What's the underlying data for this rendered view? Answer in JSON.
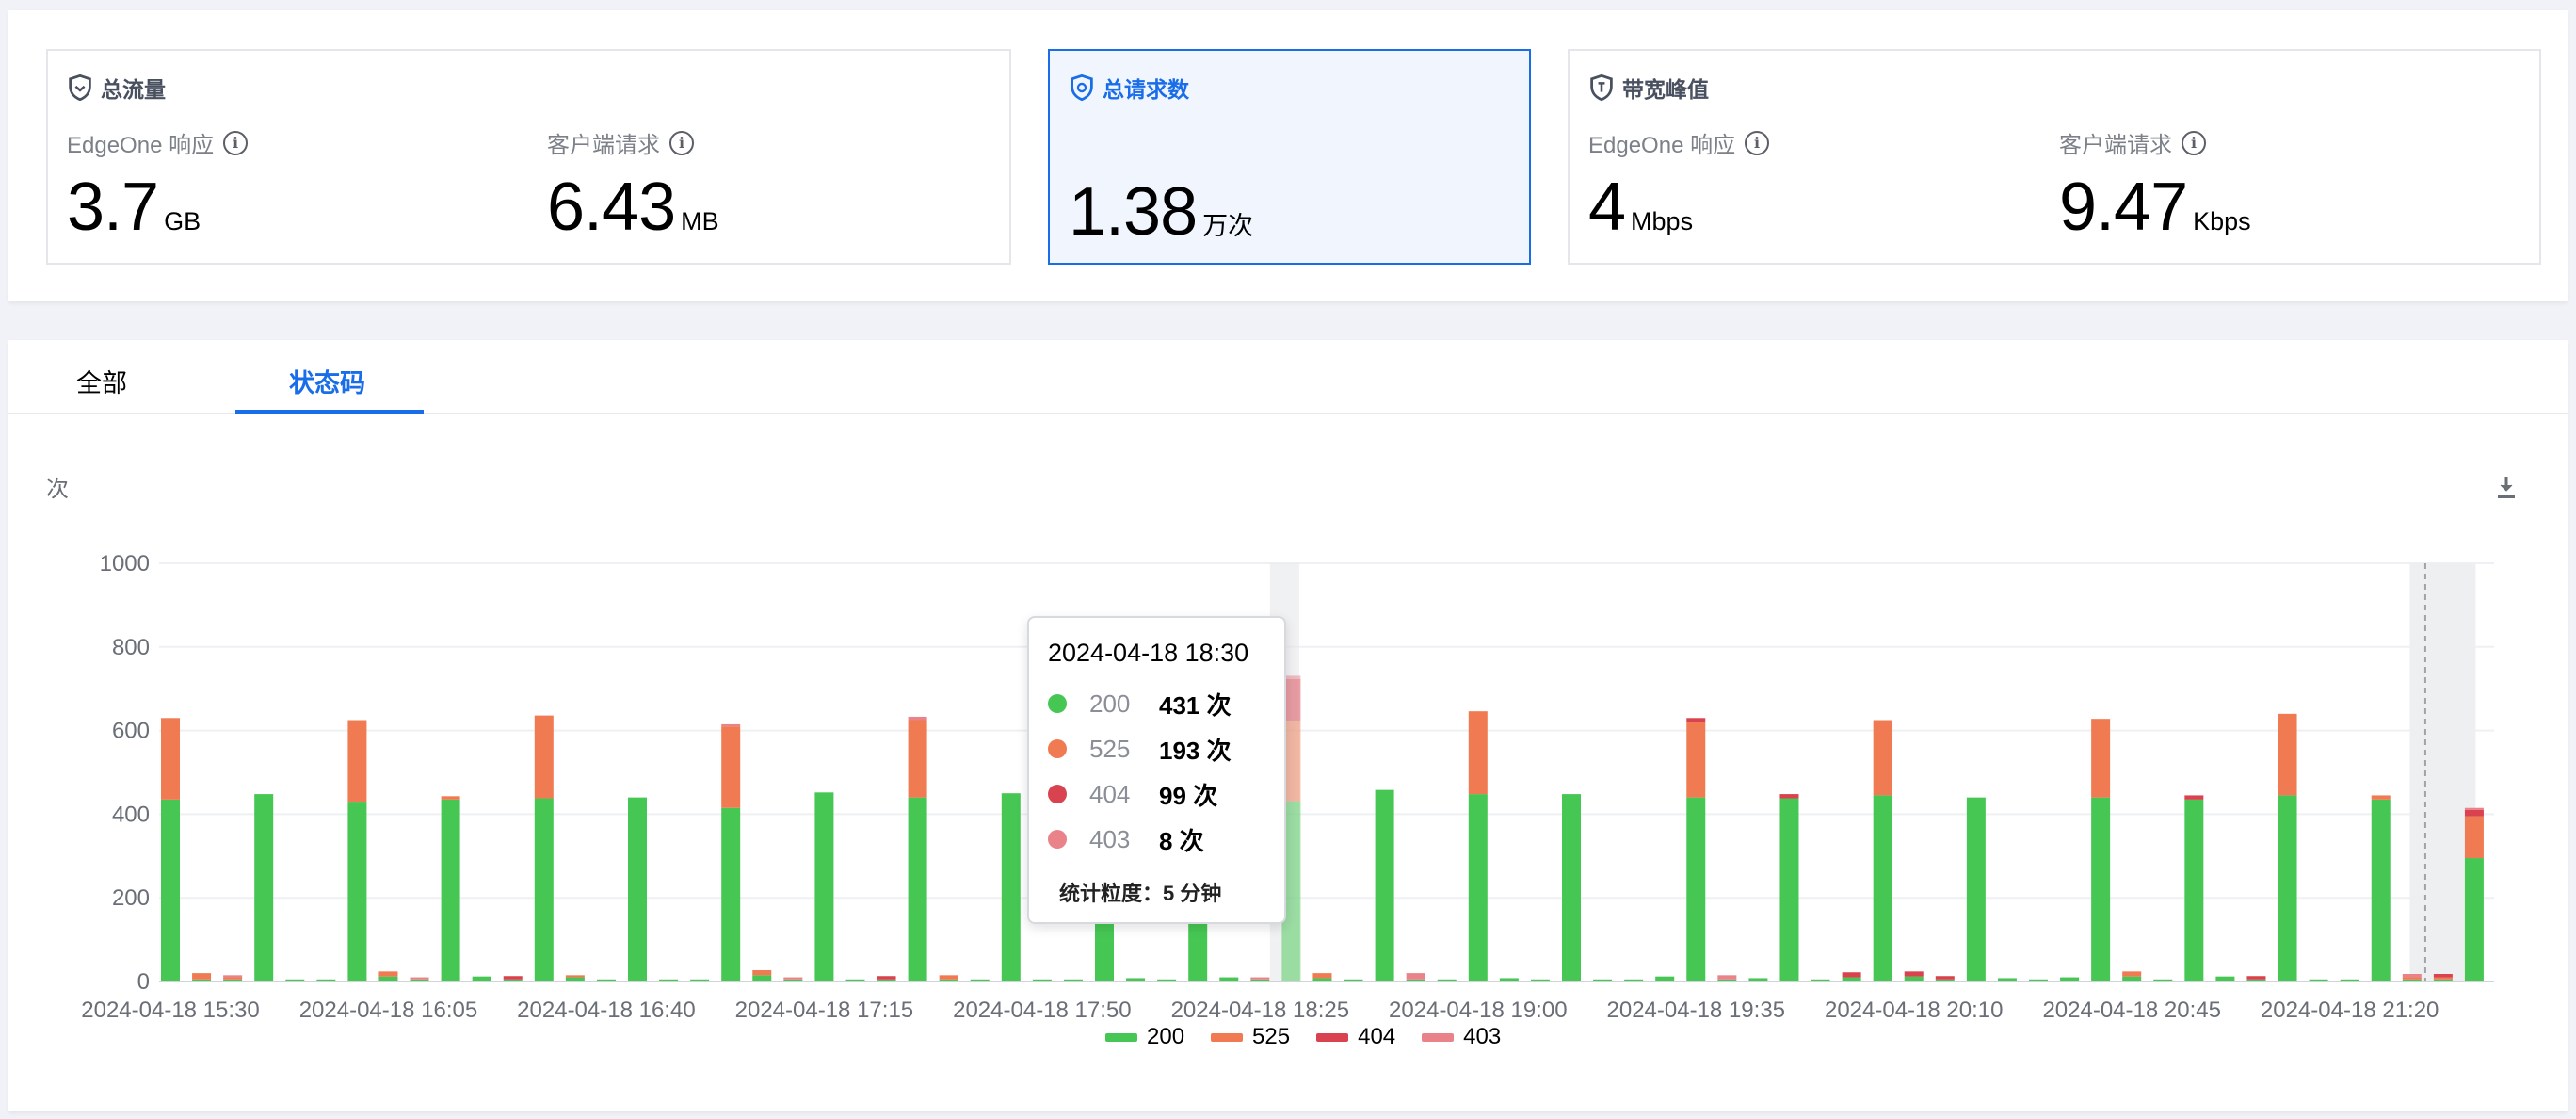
{
  "metrics": {
    "traffic": {
      "title": "总流量",
      "edge": {
        "label": "EdgeOne 响应",
        "value": "3.7",
        "unit": "GB"
      },
      "client": {
        "label": "客户端请求",
        "value": "6.43",
        "unit": "MB"
      }
    },
    "requests": {
      "title": "总请求数",
      "total": {
        "value": "1.38",
        "unit": "万次"
      }
    },
    "bandwidth": {
      "title": "带宽峰值",
      "edge": {
        "label": "EdgeOne 响应",
        "value": "4",
        "unit": "Mbps"
      },
      "client": {
        "label": "客户端请求",
        "value": "9.47",
        "unit": "Kbps"
      }
    }
  },
  "tabs": [
    {
      "label": "全部"
    },
    {
      "label": "状态码",
      "active": true
    }
  ],
  "chart_unit": "次",
  "colors": {
    "c200": "#46c753",
    "c525": "#f07b52",
    "c404": "#d9434f",
    "c403": "#ea8289",
    "accent": "#1a6de8"
  },
  "icons": {
    "shield": "shield-icon",
    "info": "info-icon",
    "download": "download-icon"
  },
  "tooltip": {
    "title": "2024-04-18 18:30",
    "rows": [
      {
        "code": "200",
        "value": "431 次"
      },
      {
        "code": "525",
        "value": "193 次"
      },
      {
        "code": "404",
        "value": "99 次"
      },
      {
        "code": "403",
        "value": "8 次"
      }
    ],
    "footer": "统计粒度：5 分钟"
  },
  "chart_data": {
    "type": "bar",
    "stacked": true,
    "ylim": [
      0,
      1000
    ],
    "yticks": [
      0,
      200,
      400,
      600,
      800,
      1000
    ],
    "x_tick_labels": [
      "2024-04-18 15:30",
      "2024-04-18 16:05",
      "2024-04-18 16:40",
      "2024-04-18 17:15",
      "2024-04-18 17:50",
      "2024-04-18 18:25",
      "2024-04-18 19:00",
      "2024-04-18 19:35",
      "2024-04-18 20:10",
      "2024-04-18 20:45",
      "2024-04-18 21:20"
    ],
    "x_tick_indices": [
      0,
      7,
      14,
      21,
      28,
      35,
      42,
      49,
      56,
      63,
      70
    ],
    "highlight_index": 36,
    "grid": true,
    "legend": "bottom-center",
    "series": [
      {
        "name": "200",
        "values": [
          435,
          5,
          5,
          448,
          5,
          5,
          430,
          12,
          5,
          435,
          12,
          5,
          438,
          10,
          5,
          440,
          5,
          5,
          415,
          15,
          5,
          452,
          5,
          5,
          440,
          5,
          5,
          450,
          5,
          5,
          450,
          8,
          5,
          450,
          10,
          5,
          431,
          8,
          5,
          458,
          5,
          5,
          448,
          8,
          5,
          448,
          5,
          5,
          12,
          440,
          5,
          8,
          438,
          5,
          10,
          445,
          12,
          5,
          440,
          8,
          5,
          10,
          440,
          12,
          5,
          435,
          12,
          5,
          445,
          5,
          5,
          435,
          5,
          5,
          295
        ]
      },
      {
        "name": "525",
        "values": [
          195,
          15,
          5,
          0,
          0,
          0,
          195,
          12,
          0,
          8,
          0,
          0,
          198,
          5,
          0,
          0,
          0,
          0,
          195,
          12,
          0,
          0,
          0,
          0,
          185,
          10,
          0,
          0,
          0,
          0,
          150,
          0,
          0,
          160,
          0,
          0,
          193,
          12,
          0,
          0,
          0,
          0,
          198,
          0,
          0,
          0,
          0,
          0,
          0,
          180,
          0,
          0,
          0,
          0,
          0,
          180,
          0,
          0,
          0,
          0,
          0,
          0,
          188,
          12,
          0,
          0,
          0,
          0,
          195,
          0,
          0,
          10,
          5,
          5,
          100
        ]
      },
      {
        "name": "404",
        "values": [
          0,
          0,
          0,
          0,
          0,
          0,
          0,
          0,
          0,
          0,
          0,
          8,
          0,
          0,
          0,
          0,
          0,
          0,
          0,
          0,
          0,
          0,
          0,
          8,
          0,
          0,
          0,
          0,
          0,
          0,
          12,
          0,
          0,
          15,
          0,
          0,
          99,
          0,
          0,
          0,
          0,
          0,
          0,
          0,
          0,
          0,
          0,
          0,
          0,
          10,
          0,
          0,
          10,
          0,
          12,
          0,
          12,
          8,
          0,
          0,
          0,
          0,
          0,
          0,
          0,
          10,
          0,
          8,
          0,
          0,
          0,
          0,
          0,
          8,
          15
        ]
      },
      {
        "name": "403",
        "values": [
          0,
          0,
          5,
          0,
          0,
          0,
          0,
          0,
          5,
          0,
          0,
          0,
          0,
          0,
          0,
          0,
          0,
          0,
          5,
          0,
          5,
          0,
          0,
          0,
          8,
          0,
          0,
          0,
          0,
          0,
          0,
          0,
          0,
          0,
          0,
          5,
          8,
          0,
          0,
          0,
          15,
          0,
          0,
          0,
          0,
          0,
          0,
          0,
          0,
          0,
          10,
          0,
          0,
          0,
          0,
          0,
          0,
          0,
          0,
          0,
          0,
          0,
          0,
          0,
          0,
          0,
          0,
          0,
          0,
          0,
          0,
          0,
          8,
          0,
          5
        ]
      }
    ]
  }
}
